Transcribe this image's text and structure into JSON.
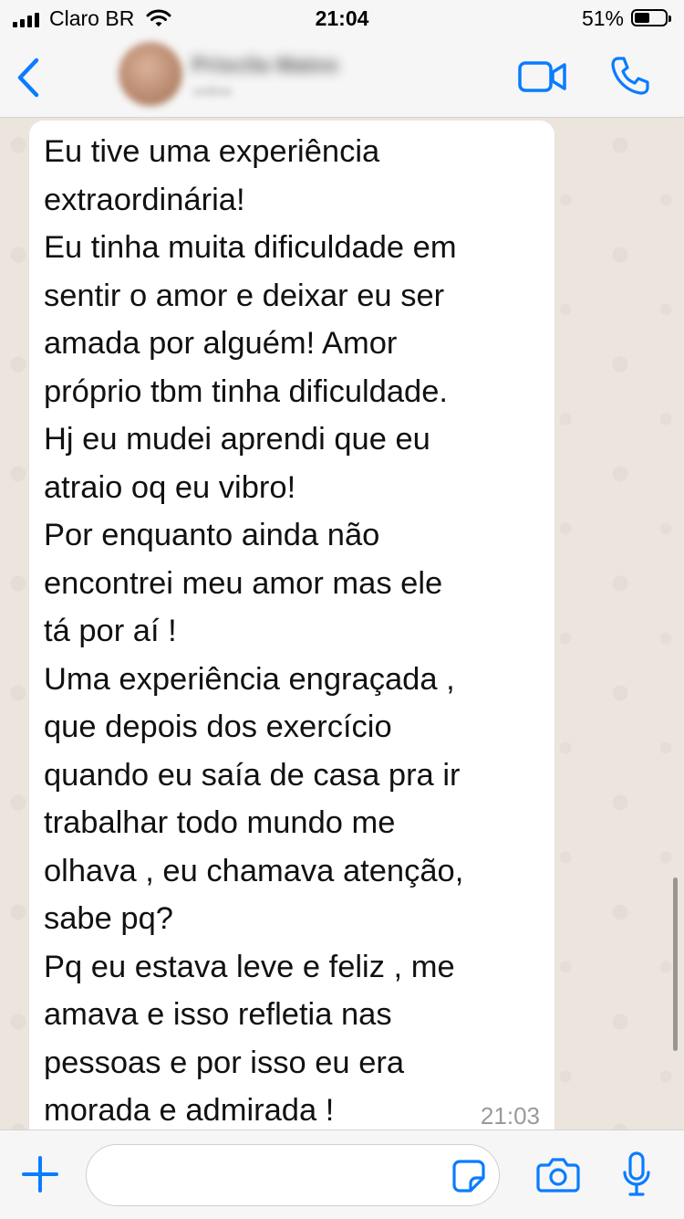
{
  "status_bar": {
    "carrier": "Claro BR",
    "time": "21:04",
    "battery_percent": "51%",
    "battery_level": 0.51,
    "icons": [
      "signal-icon",
      "wifi-icon",
      "battery-icon"
    ]
  },
  "header": {
    "back_icon": "chevron-left-icon",
    "contact_name": "Priscila Matos",
    "contact_status": "online",
    "video_icon": "video-camera-icon",
    "call_icon": "phone-icon"
  },
  "message": {
    "text": "Eu tive uma experiência\nextraordinária!\nEu tinha muita dificuldade em\nsentir o amor e deixar eu ser\namada por alguém! Amor\npróprio tbm tinha dificuldade.\nHj eu mudei aprendi que eu\natraio oq eu vibro!\nPor enquanto ainda não\nencontrei meu amor mas ele\ntá por aí !\nUma experiência engraçada ,\nque depois dos exercício\nquando eu saía de casa pra ir\ntrabalhar todo mundo me\nolhava , eu chamava atenção,\nsabe pq?\nPq eu estava leve e feliz , me\namava e isso refletia nas\npessoas e por isso eu era\nmorada e admirada !",
    "time": "21:03"
  },
  "input_bar": {
    "plus_icon": "plus-icon",
    "input_value": "",
    "sticker_icon": "sticker-icon",
    "camera_icon": "camera-icon",
    "mic_icon": "microphone-icon"
  },
  "colors": {
    "accent": "#0a7cff",
    "chat_background": "#ece5dd",
    "bubble": "#ffffff",
    "bar_background": "#f6f6f6"
  }
}
